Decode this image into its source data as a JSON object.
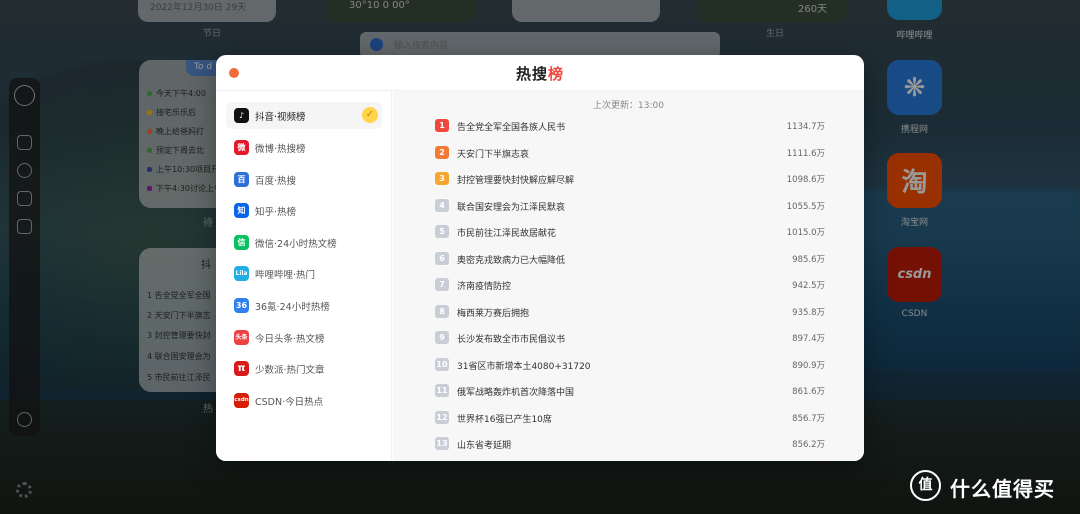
{
  "background": {
    "top_cards": [
      {
        "text": "2022年12月30日  29天",
        "label": "节日"
      },
      {
        "text": "30°10 0 00°",
        "label": ""
      },
      {
        "text": "",
        "label": ""
      },
      {
        "text": "260天",
        "label": "生日"
      }
    ],
    "search_placeholder": "输入搜索内容",
    "todo_tab": "To d",
    "todo_items": [
      {
        "text": "今天下午4:00",
        "color": "#4caf50"
      },
      {
        "text": "接宅乐乐后",
        "color": "#ffc107"
      },
      {
        "text": "晚上给爸妈打",
        "color": "#ff7043"
      },
      {
        "text": "预定下周去北",
        "color": "#4caf50"
      },
      {
        "text": "上午10:30项目开",
        "color": "#3f51b5"
      },
      {
        "text": "下午4:30讨论上午",
        "color": "#9c27b0"
      }
    ],
    "todo_label": "待",
    "hot_widget_title": "抖",
    "hot_widget_items": [
      "1 告全党全军全国",
      "2 天安门下半旗志",
      "3 封控管理要快封",
      "4 联合国安理会为",
      "5 市民前往江泽民"
    ],
    "hot_widget_label": "热"
  },
  "apps": [
    {
      "name": "哔哩哔哩",
      "color": "#1fa1e0",
      "glyph": "▭"
    },
    {
      "name": "携程网",
      "color": "#2a7de1",
      "glyph": "❋"
    },
    {
      "name": "淘宝网",
      "color": "#ff5000",
      "glyph": "淘"
    },
    {
      "name": "CSDN",
      "color": "#d81e06",
      "glyph": "csdn"
    }
  ],
  "modal": {
    "title_main": "热搜",
    "title_accent": "榜",
    "updated_label": "上次更新：13:00",
    "sources": [
      {
        "label": "抖音·视频榜",
        "icon": "douyin-icon",
        "color": "#111111",
        "glyph": "♪",
        "active": true
      },
      {
        "label": "微博·热搜榜",
        "icon": "weibo-icon",
        "color": "#e6162d",
        "glyph": "微"
      },
      {
        "label": "百度·热搜",
        "icon": "baidu-icon",
        "color": "#2f6fd8",
        "glyph": "百"
      },
      {
        "label": "知乎·热榜",
        "icon": "zhihu-icon",
        "color": "#0a66e8",
        "glyph": "知"
      },
      {
        "label": "微信·24小时热文榜",
        "icon": "wechat-icon",
        "color": "#07c160",
        "glyph": "信"
      },
      {
        "label": "哔哩哔哩·热门",
        "icon": "bilibili-icon",
        "color": "#23ade5",
        "glyph": "Lila"
      },
      {
        "label": "36氪·24小时热榜",
        "icon": "36kr-icon",
        "color": "#2f7ff0",
        "glyph": "36"
      },
      {
        "label": "今日头条·热文榜",
        "icon": "toutiao-icon",
        "color": "#f04142",
        "glyph": "头条"
      },
      {
        "label": "少数派·热门文章",
        "icon": "sspai-icon",
        "color": "#d71a1b",
        "glyph": "π"
      },
      {
        "label": "CSDN·今日热点",
        "icon": "csdn-icon",
        "color": "#d81e06",
        "glyph": "csdn"
      }
    ],
    "rank_colors": {
      "1": "#f0473e",
      "2": "#f47a35",
      "3": "#f7a531",
      "default": "#c9ced6"
    },
    "items": [
      {
        "rank": "1",
        "title": "告全党全军全国各族人民书",
        "heat": "1134.7万"
      },
      {
        "rank": "2",
        "title": "天安门下半旗志哀",
        "heat": "1111.6万"
      },
      {
        "rank": "3",
        "title": "封控管理要快封快解应解尽解",
        "heat": "1098.6万"
      },
      {
        "rank": "4",
        "title": "联合国安理会为江泽民默哀",
        "heat": "1055.5万"
      },
      {
        "rank": "5",
        "title": "市民前往江泽民故居献花",
        "heat": "1015.0万"
      },
      {
        "rank": "6",
        "title": "奥密克戎致病力已大幅降低",
        "heat": "985.6万"
      },
      {
        "rank": "7",
        "title": "济南疫情防控",
        "heat": "942.5万"
      },
      {
        "rank": "8",
        "title": "梅西莱万赛后拥抱",
        "heat": "935.8万"
      },
      {
        "rank": "9",
        "title": "长沙发布致全市市民倡议书",
        "heat": "897.4万"
      },
      {
        "rank": "10",
        "title": "31省区市新增本土4080+31720",
        "heat": "890.9万"
      },
      {
        "rank": "11",
        "title": "俄军战略轰炸机首次降落中国",
        "heat": "861.6万"
      },
      {
        "rank": "12",
        "title": "世界杯16强已产生10席",
        "heat": "856.7万"
      },
      {
        "rank": "13",
        "title": "山东省考延期",
        "heat": "856.2万"
      }
    ]
  },
  "watermark": {
    "circle": "值",
    "text": "什么值得买"
  }
}
